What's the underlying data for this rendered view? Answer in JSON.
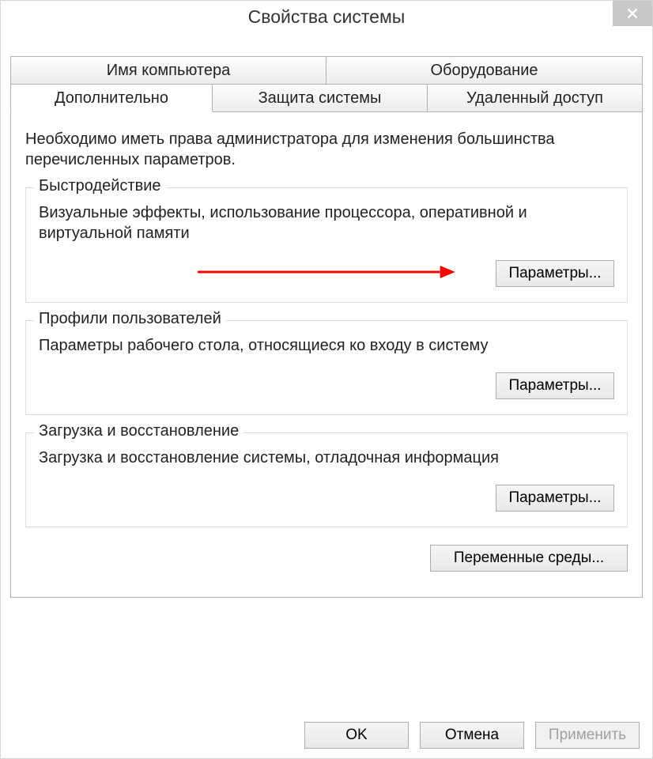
{
  "window": {
    "title": "Свойства системы"
  },
  "tabs": {
    "row1": [
      {
        "label": "Имя компьютера"
      },
      {
        "label": "Оборудование"
      }
    ],
    "row2": [
      {
        "label": "Дополнительно",
        "active": true
      },
      {
        "label": "Защита системы"
      },
      {
        "label": "Удаленный доступ"
      }
    ]
  },
  "panel": {
    "admin_note": "Необходимо иметь права администратора для изменения большинства перечисленных параметров.",
    "groups": {
      "performance": {
        "legend": "Быстродействие",
        "desc": "Визуальные эффекты, использование процессора, оперативной и виртуальной памяти",
        "button": "Параметры..."
      },
      "profiles": {
        "legend": "Профили пользователей",
        "desc": "Параметры рабочего стола, относящиеся ко входу в систему",
        "button": "Параметры..."
      },
      "startup": {
        "legend": "Загрузка и восстановление",
        "desc": "Загрузка и восстановление системы, отладочная информация",
        "button": "Параметры..."
      }
    },
    "env_button": "Переменные среды..."
  },
  "dialog_buttons": {
    "ok": "OK",
    "cancel": "Отмена",
    "apply": "Применить"
  }
}
